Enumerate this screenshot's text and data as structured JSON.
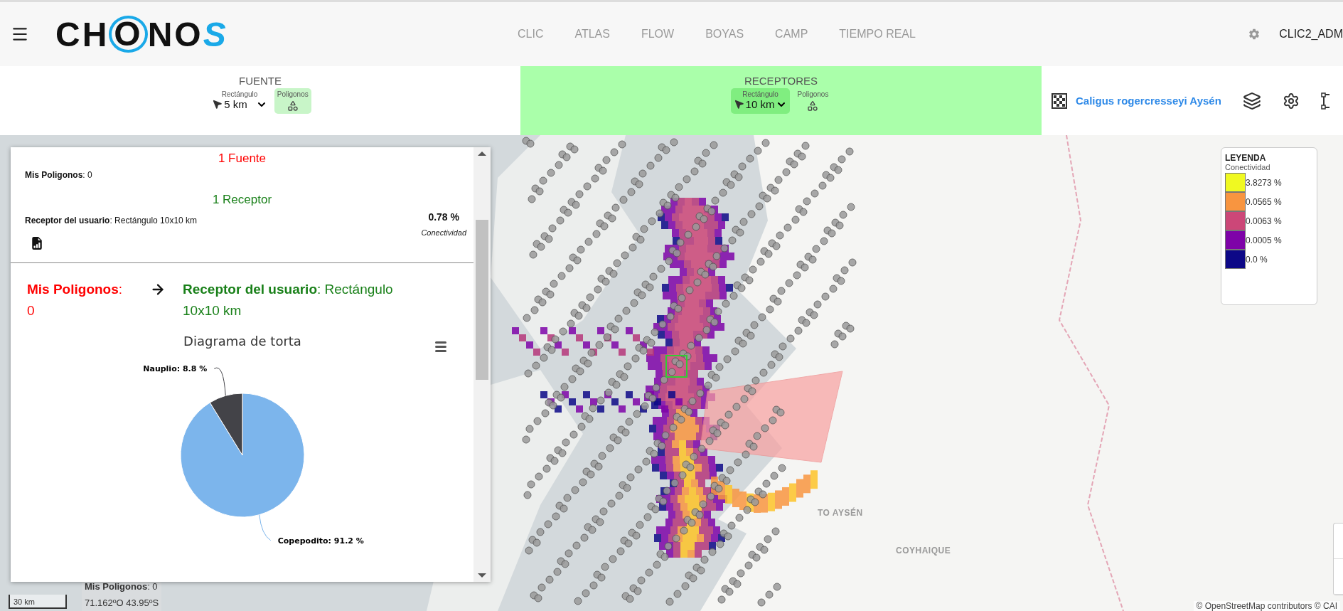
{
  "header": {
    "logo": "CHONOS",
    "nav": [
      "CLIC",
      "ATLAS",
      "FLOW",
      "BOYAS",
      "CAMP",
      "TIEMPO REAL"
    ],
    "user": "CLIC2_ADM"
  },
  "toolbar": {
    "sections": [
      {
        "title": "FUENTE",
        "active": false,
        "options": [
          {
            "kind": "dropdown",
            "label": "Rectángulo",
            "value": "5 km",
            "selected": false
          },
          {
            "kind": "shapes",
            "label": "Poligonos",
            "selected": true
          }
        ]
      },
      {
        "title": "RECEPTORES",
        "active": true,
        "options": [
          {
            "kind": "dropdown",
            "label": "Rectángulo",
            "value": "10 km",
            "selected": true
          },
          {
            "kind": "shapes",
            "label": "Poligonos",
            "selected": false
          }
        ]
      }
    ],
    "species": "Caligus rogercresseyi Aysén"
  },
  "panel": {
    "source_heading": "1 Fuente",
    "source": "**Mis Poligonos**: 0",
    "receptor_heading": "1 Receptor",
    "receptor": "**Receptor del usuario**: Rectángulo 10x10 km",
    "connectivity": "0.78 %",
    "connectivity_label": "Conectividad",
    "flow": {
      "from": "**Mis Poligonos**: 0",
      "to": "**Receptor del usuario**: Rectángulo 10x10 km"
    },
    "chart_data": {
      "type": "pie",
      "title": "Diagrama de torta",
      "categories": [
        "Copepodito: 91.2 %",
        "Nauplio: 8.8 %"
      ],
      "values": [
        91.2,
        8.8
      ],
      "colors": [
        "#7cb5ec",
        "#434348"
      ]
    }
  },
  "legend": {
    "title": "LEYENDA",
    "subtitle": "Conectividad",
    "items": [
      {
        "label": "3.8273 %",
        "color": "#f0f921"
      },
      {
        "label": "0.0565 %",
        "color": "#f89540"
      },
      {
        "label": "0.0063 %",
        "color": "#cc4778"
      },
      {
        "label": "0.0005 %",
        "color": "#7e03a8"
      },
      {
        "label": "0.0 %",
        "color": "#0d0887"
      }
    ]
  },
  "map": {
    "labels": [
      "TO AYSÉN",
      "COYHAIQUE"
    ],
    "attribution": "© OpenStreetMap contributors © CAI",
    "scale": "30 km",
    "cursor": {
      "label": "**Mis Poligonos**: 0",
      "coords": "71.162ºO 43.95ºS"
    }
  }
}
